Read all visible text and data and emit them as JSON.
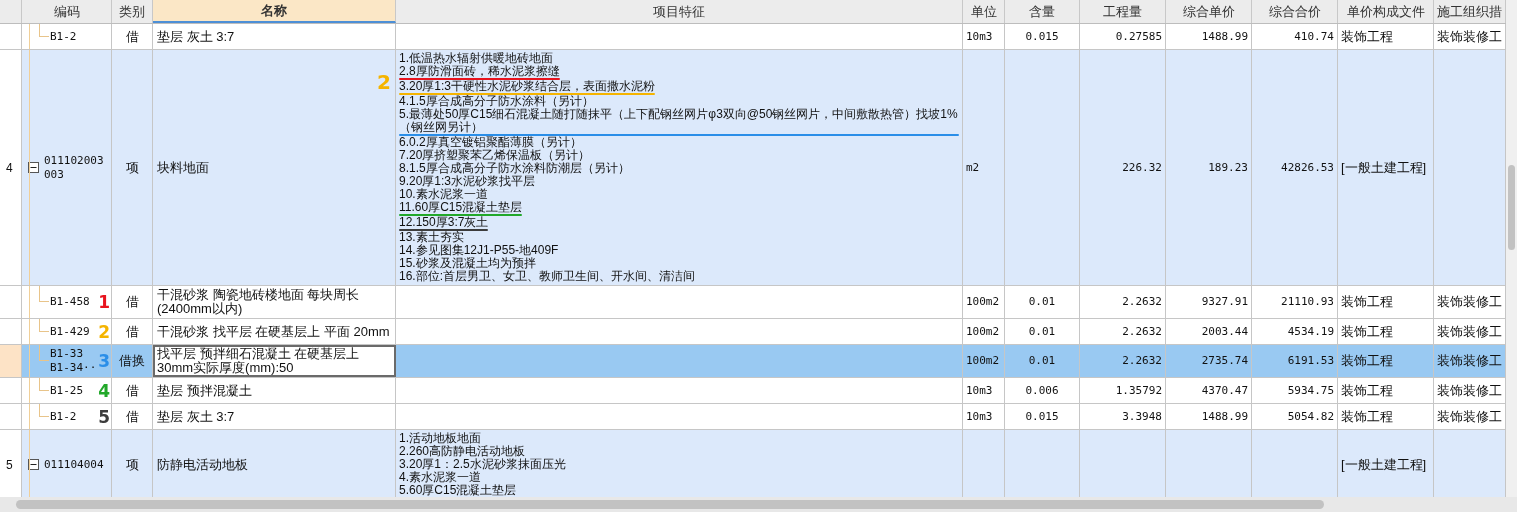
{
  "columns": [
    {
      "selected": false
    },
    {
      "label": "编码",
      "selected": false
    },
    {
      "label": "类别",
      "selected": false
    },
    {
      "label": "名称",
      "selected": true
    },
    {
      "label": "项目特征",
      "selected": false
    },
    {
      "label": "单位",
      "selected": false
    },
    {
      "label": "含量",
      "selected": false
    },
    {
      "label": "工程量",
      "selected": false
    },
    {
      "label": "综合单价",
      "selected": false
    },
    {
      "label": "综合合价",
      "selected": false
    },
    {
      "label": "单价构成文件",
      "selected": false
    },
    {
      "label": "施工组织措",
      "selected": false
    }
  ],
  "rows": [
    {
      "kind": "sub",
      "number": "",
      "code": [
        "B1-2"
      ],
      "type": "借",
      "name": "垫层 灰土 3:7",
      "features": [],
      "unit": "10m3",
      "quantity": "0.015",
      "amount": "0.27585",
      "unit_price": "1488.99",
      "total": "410.74",
      "price_file": "装饰工程",
      "construction": "装饰装修工",
      "selected": false
    },
    {
      "kind": "item",
      "number": "4",
      "code": [
        "011102003",
        "003"
      ],
      "expanded": true,
      "type": "项",
      "name": "块料地面",
      "annotation": {
        "text": "2",
        "color": "#f5b400"
      },
      "features": [
        {
          "text": "1.低温热水辐射供暖地砖地面"
        },
        {
          "text": "2.8厚防滑面砖，稀水泥浆擦缝",
          "color": "#e8141e"
        },
        {
          "text": "3.20厚1:3干硬性水泥砂浆结合层，表面撒水泥粉",
          "color": "#f5b400"
        },
        {
          "text": "4.1.5厚合成高分子防水涂料（另计）"
        },
        {
          "text": "5.最薄处50厚C15细石混凝土随打随抹平（上下配钢丝网片φ3双向@50钢丝网片，中间敷散热管）找坡1%（钢丝网另计）",
          "color": "#2a8ee8"
        },
        {
          "text": "6.0.2厚真空镀铝聚酯薄膜（另计）"
        },
        {
          "text": "7.20厚挤塑聚苯乙烯保温板（另计）"
        },
        {
          "text": "8.1.5厚合成高分子防水涂料防潮层（另计）"
        },
        {
          "text": "9.20厚1:3水泥砂浆找平层"
        },
        {
          "text": "10.素水泥浆一道"
        },
        {
          "text": "11.60厚C15混凝土垫层",
          "color": "#22a82a"
        },
        {
          "text": "12.150厚3:7灰土",
          "color": "#3c3c3c"
        },
        {
          "text": "13.素土夯实"
        },
        {
          "text": "14.参见图集12J1-P55-地409F"
        },
        {
          "text": "15.砂浆及混凝土均为预拌"
        },
        {
          "text": "16.部位:首层男卫、女卫、教师卫生间、开水间、清洁间"
        }
      ],
      "unit": "m2",
      "quantity": "",
      "amount": "226.32",
      "unit_price": "189.23",
      "total": "42826.53",
      "price_file": "[一般土建工程]",
      "construction": "",
      "selected": false
    },
    {
      "kind": "sub",
      "number": "",
      "code": [
        "B1-458"
      ],
      "type": "借",
      "name": "干混砂浆 陶瓷地砖楼地面 每块周长(2400mm以内)",
      "annotation": {
        "text": "1",
        "color": "#e8141e"
      },
      "features": [],
      "unit": "100m2",
      "quantity": "0.01",
      "amount": "2.2632",
      "unit_price": "9327.91",
      "total": "21110.93",
      "price_file": "装饰工程",
      "construction": "装饰装修工",
      "selected": false
    },
    {
      "kind": "sub",
      "number": "",
      "code": [
        "B1-429"
      ],
      "type": "借",
      "name": "干混砂浆 找平层 在硬基层上 平面 20mm",
      "annotation": {
        "text": "2",
        "color": "#f5b400"
      },
      "features": [],
      "unit": "100m2",
      "quantity": "0.01",
      "amount": "2.2632",
      "unit_price": "2003.44",
      "total": "4534.19",
      "price_file": "装饰工程",
      "construction": "装饰装修工",
      "selected": false
    },
    {
      "kind": "sub",
      "number": "",
      "code": [
        "B1-33",
        "B1-34··"
      ],
      "type": "借换",
      "name": "找平层 预拌细石混凝土 在硬基层上 30mm实际厚度(mm):50",
      "annotation": {
        "text": "3",
        "color": "#2a8ee8"
      },
      "features": [],
      "unit": "100m2",
      "quantity": "0.01",
      "amount": "2.2632",
      "unit_price": "2735.74",
      "total": "6191.53",
      "price_file": "装饰工程",
      "construction": "装饰装修工",
      "selected": true
    },
    {
      "kind": "sub",
      "number": "",
      "code": [
        "B1-25"
      ],
      "type": "借",
      "name": "垫层 预拌混凝土",
      "annotation": {
        "text": "4",
        "color": "#22a82a"
      },
      "features": [],
      "unit": "10m3",
      "quantity": "0.006",
      "amount": "1.35792",
      "unit_price": "4370.47",
      "total": "5934.75",
      "price_file": "装饰工程",
      "construction": "装饰装修工",
      "selected": false
    },
    {
      "kind": "sub",
      "number": "",
      "code": [
        "B1-2"
      ],
      "type": "借",
      "name": "垫层 灰土 3:7",
      "annotation": {
        "text": "5",
        "color": "#3c3c3c"
      },
      "features": [],
      "unit": "10m3",
      "quantity": "0.015",
      "amount": "3.3948",
      "unit_price": "1488.99",
      "total": "5054.82",
      "price_file": "装饰工程",
      "construction": "装饰装修工",
      "selected": false
    },
    {
      "kind": "item",
      "number": "5",
      "code": [
        "011104004"
      ],
      "expanded": true,
      "type": "项",
      "name": "防静电活动地板",
      "features": [
        {
          "text": "1.活动地板地面"
        },
        {
          "text": "2.260高防静电活动地板"
        },
        {
          "text": "3.20厚1：2.5水泥砂浆抹面压光"
        },
        {
          "text": "4.素水泥浆一道"
        },
        {
          "text": "5.60厚C15混凝土垫层"
        }
      ],
      "unit": "",
      "quantity": "",
      "amount": "",
      "unit_price": "",
      "total": "",
      "price_file": "[一般土建工程]",
      "construction": "",
      "selected": false
    }
  ]
}
